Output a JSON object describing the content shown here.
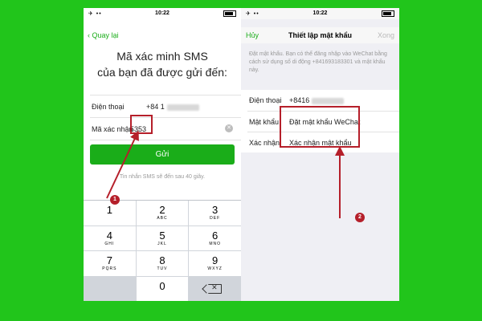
{
  "left_screen": {
    "status": {
      "carrier": "✈ ••",
      "time": "10:22"
    },
    "nav": {
      "back_label": "Quay lại"
    },
    "headline_line1": "Mã xác minh SMS",
    "headline_line2": "của bạn đã được gửi đến:",
    "phone_row": {
      "label": "Điện thoại",
      "value": "+84 1"
    },
    "code_row": {
      "label": "Mã xác nhận",
      "value": "5353"
    },
    "send_button": "Gửi",
    "sms_note": "Tin nhắn SMS sẽ đến sau 40 giây.",
    "keypad": [
      {
        "d": "1",
        "s": ""
      },
      {
        "d": "2",
        "s": "ABC"
      },
      {
        "d": "3",
        "s": "DEF"
      },
      {
        "d": "4",
        "s": "GHI"
      },
      {
        "d": "5",
        "s": "JKL"
      },
      {
        "d": "6",
        "s": "MNO"
      },
      {
        "d": "7",
        "s": "PQRS"
      },
      {
        "d": "8",
        "s": "TUV"
      },
      {
        "d": "9",
        "s": "WXYZ"
      },
      {
        "d": "0",
        "s": ""
      }
    ],
    "badge": "1"
  },
  "right_screen": {
    "status": {
      "carrier": "✈ ••",
      "time": "10:22"
    },
    "nav": {
      "cancel_label": "Hủy",
      "title": "Thiết lập mật khẩu",
      "done_label": "Xong"
    },
    "info_text": "Đặt mật khẩu. Bạn có thể đăng nhập vào WeChat bằng cách sử dụng số di động +841693183301 và mật khẩu này.",
    "phone_row": {
      "label": "Điện thoại",
      "value": "+8416"
    },
    "password_row": {
      "label": "Mật khẩu",
      "placeholder": "Đặt mật khẩu WeChat"
    },
    "confirm_row": {
      "label": "Xác nhận",
      "placeholder": "Xác nhận mật khẩu"
    },
    "badge": "2"
  },
  "colors": {
    "background": "#21c51b",
    "accent": "#1aad19",
    "annotation": "#b51f2a"
  }
}
